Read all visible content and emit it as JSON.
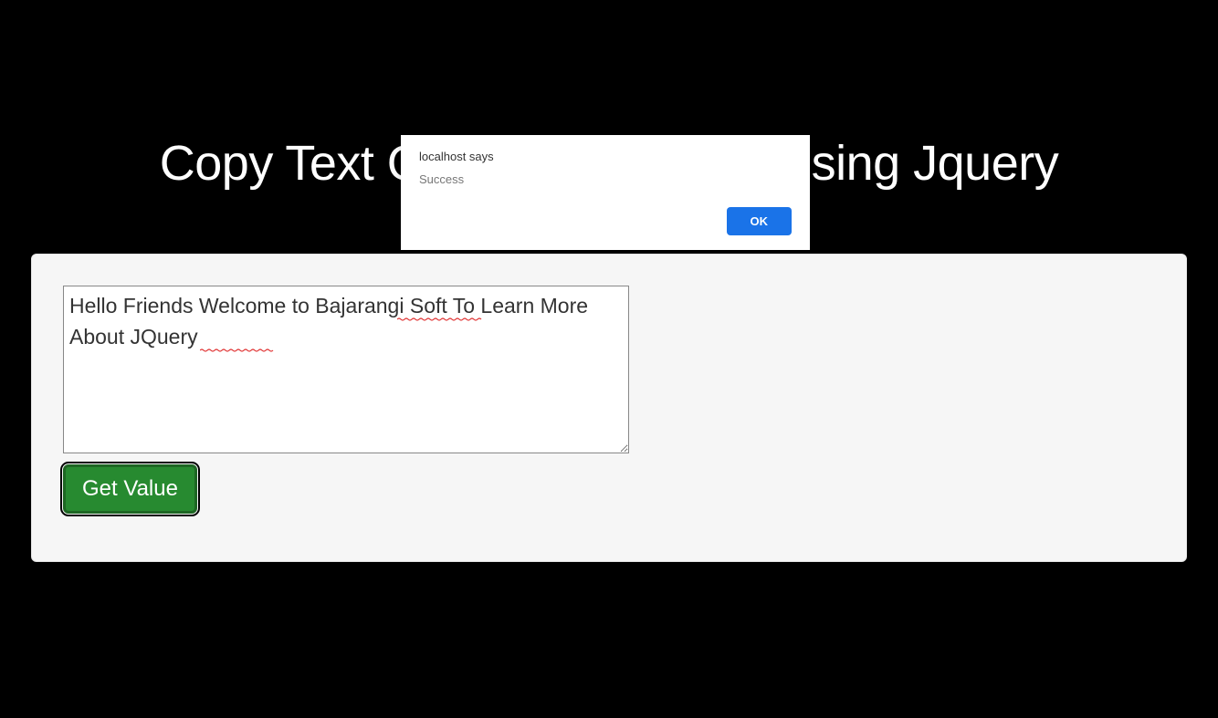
{
  "alert": {
    "origin": "localhost says",
    "message": "Success",
    "ok_label": "OK"
  },
  "heading": "Copy Text Onclick Of Button Using Jquery",
  "textarea": {
    "value": "Hello Friends Welcome to Bajarangi Soft To Learn More About JQuery"
  },
  "button": {
    "label": "Get Value"
  }
}
